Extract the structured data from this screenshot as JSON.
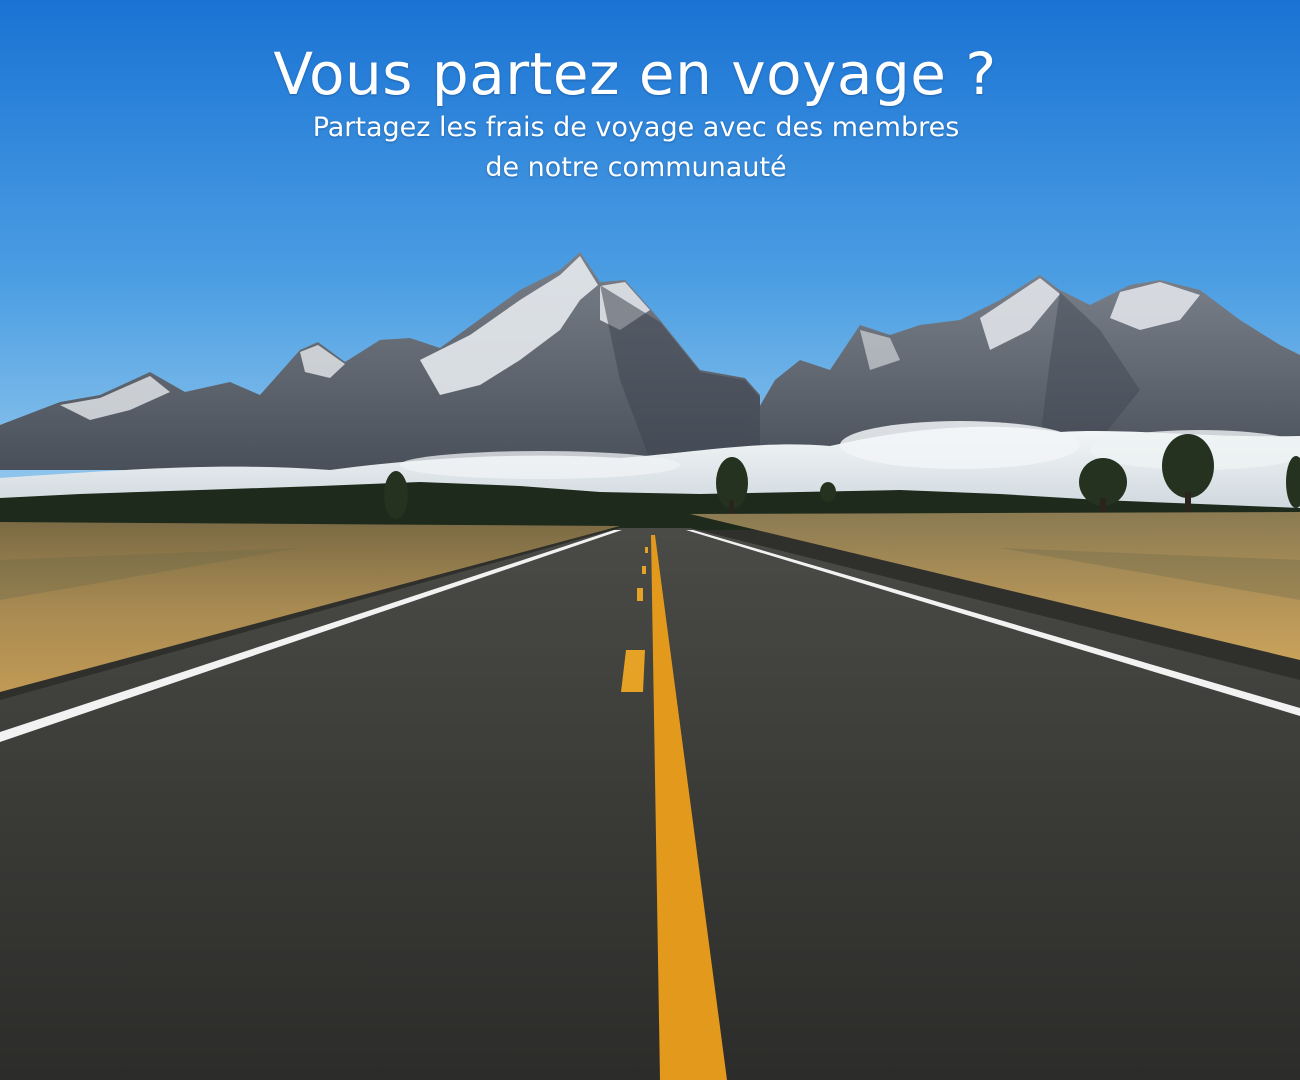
{
  "hero": {
    "title": "Vous partez en voyage ?",
    "subtitle_line1": "Partagez les frais de voyage avec des membres",
    "subtitle_line2": "de notre communauté"
  },
  "colors": {
    "sky_top": "#1c78d8",
    "sky_bottom": "#8cc4ea",
    "snow": "#e8ecf0",
    "rock": "#5c626c",
    "cloud": "#eef2f4",
    "forest": "#1f2a1c",
    "grass": "#b0915a",
    "asphalt": "#3a3a37",
    "center_line": "#e39a1c",
    "edge_line": "#f2f2f2",
    "text": "#ffffff"
  }
}
